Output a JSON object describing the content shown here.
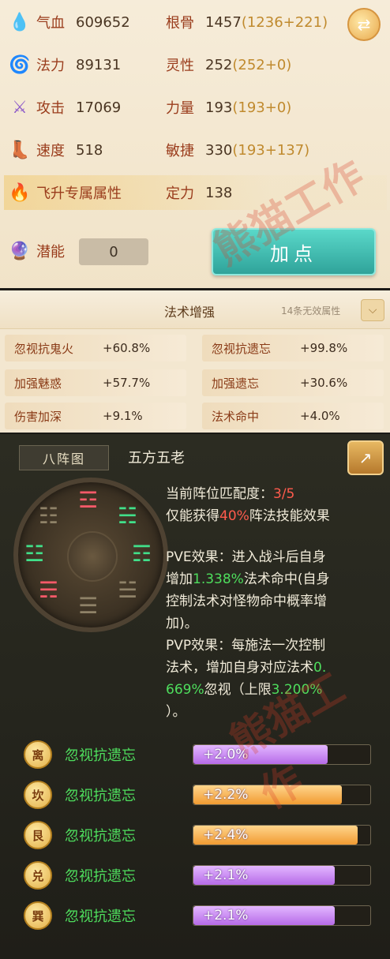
{
  "attrs": {
    "qixue": {
      "label": "气血",
      "value": "609652"
    },
    "fali": {
      "label": "法力",
      "value": "89131"
    },
    "gongji": {
      "label": "攻击",
      "value": "17069"
    },
    "sudu": {
      "label": "速度",
      "value": "518"
    },
    "feisheng": {
      "label": "飞升专属属性"
    },
    "qianneng": {
      "label": "潜能",
      "value": "0"
    },
    "gengu": {
      "label": "根骨",
      "value": "1457",
      "bonus": "(1236+221)"
    },
    "lingxing": {
      "label": "灵性",
      "value": "252",
      "bonus": "(252+0)"
    },
    "liliang": {
      "label": "力量",
      "value": "193",
      "bonus": "(193+0)"
    },
    "minjie": {
      "label": "敏捷",
      "value": "330",
      "bonus": "(193+137)"
    },
    "dingli": {
      "label": "定力",
      "value": "138"
    }
  },
  "add_button": "加点",
  "watermark": "熊猫工作",
  "spell": {
    "title": "法术增强",
    "note": "14条无效属性",
    "cells": [
      {
        "name": "忽视抗鬼火",
        "value": "+60.8%"
      },
      {
        "name": "忽视抗遗忘",
        "value": "+99.8%"
      },
      {
        "name": "加强魅惑",
        "value": "+57.7%"
      },
      {
        "name": "加强遗忘",
        "value": "+30.6%"
      },
      {
        "name": "伤害加深",
        "value": "+9.1%"
      },
      {
        "name": "法术命中",
        "value": "+4.0%"
      }
    ]
  },
  "formation": {
    "tab": "八阵图",
    "name": "五方五老",
    "match_label": "当前阵位匹配度：",
    "match_value": "3/5",
    "gain_prefix": "仅能获得",
    "gain_pct": "40%",
    "gain_suffix": "阵法技能效果",
    "pve_1": "PVE效果：进入战斗后自身",
    "pve_2a": "增加",
    "pve_2b": "1.338%",
    "pve_2c": "法术命中(自身",
    "pve_3": "控制法术对怪物命中概率增",
    "pve_4": "加)。",
    "pvp_1": "PVP效果：每施法一次控制",
    "pvp_2a": "法术，增加自身对应法术",
    "pvp_2b": "0.",
    "pvp_3a": "669%",
    "pvp_3b": "忽视（上限",
    "pvp_3c": "3.200%",
    "pvp_4": "）。",
    "effects": [
      {
        "badge": "离",
        "name": "忽视抗遗忘",
        "value": "+2.0%",
        "fill": 0.76,
        "color": "purple"
      },
      {
        "badge": "坎",
        "name": "忽视抗遗忘",
        "value": "+2.2%",
        "fill": 0.84,
        "color": "orange"
      },
      {
        "badge": "艮",
        "name": "忽视抗遗忘",
        "value": "+2.4%",
        "fill": 0.93,
        "color": "orange"
      },
      {
        "badge": "兑",
        "name": "忽视抗遗忘",
        "value": "+2.1%",
        "fill": 0.8,
        "color": "purple"
      },
      {
        "badge": "巽",
        "name": "忽视抗遗忘",
        "value": "+2.1%",
        "fill": 0.8,
        "color": "purple"
      }
    ]
  }
}
